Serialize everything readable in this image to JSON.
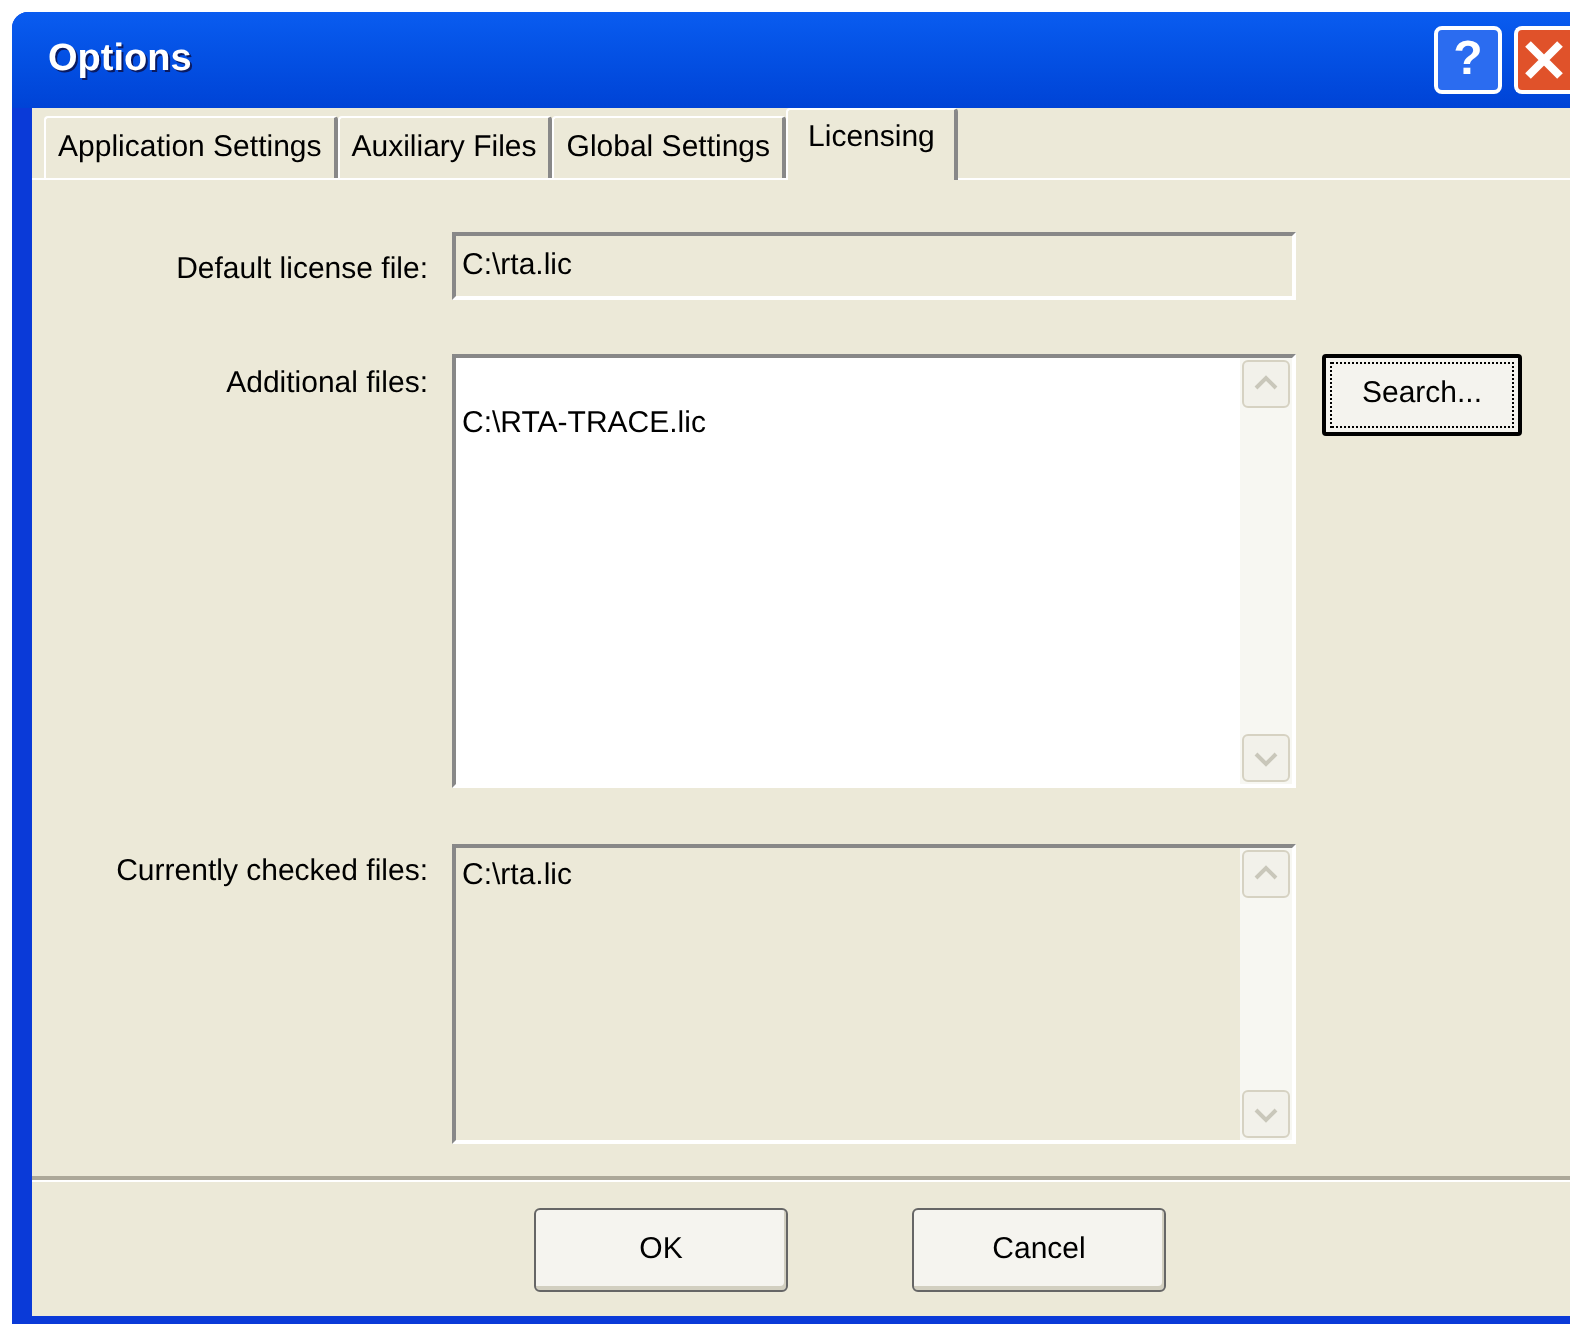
{
  "window": {
    "title": "Options",
    "help_button": "?"
  },
  "tabs": [
    {
      "label": "Application Settings",
      "selected": false
    },
    {
      "label": "Auxiliary Files",
      "selected": false
    },
    {
      "label": "Global Settings",
      "selected": false
    },
    {
      "label": "Licensing",
      "selected": true
    }
  ],
  "default_license_file": {
    "label": "Default license file:",
    "value": "C:\\rta.lic"
  },
  "additional_files": {
    "label": "Additional files:",
    "items": [
      "C:\\RTA-TRACE.lic"
    ]
  },
  "search_button": "Search...",
  "currently_checked_files": {
    "label": "Currently checked files:",
    "items": [
      "C:\\rta.lic"
    ]
  },
  "buttons": [
    "OK",
    "Cancel"
  ]
}
